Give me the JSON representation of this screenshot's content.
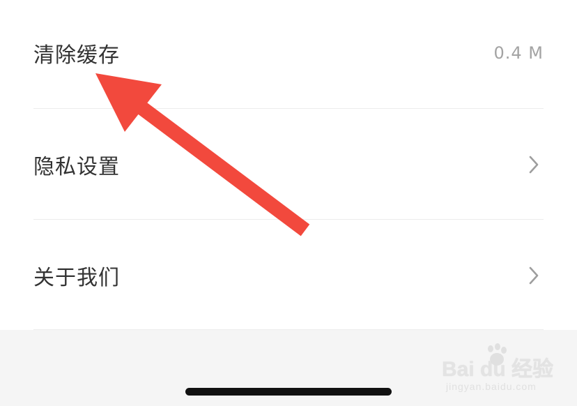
{
  "settings": {
    "items": [
      {
        "label": "清除缓存",
        "value": "0.4 M",
        "icon": "none"
      },
      {
        "label": "隐私设置",
        "value": "",
        "icon": "chevron-right-icon"
      },
      {
        "label": "关于我们",
        "value": "",
        "icon": "chevron-right-icon"
      }
    ]
  },
  "watermark": {
    "logo_text": "Bai du 经验",
    "url_text": "jingyan.baidu.com"
  },
  "colors": {
    "label": "#333333",
    "value": "#a3a3a3",
    "divider": "#ececec",
    "chevron": "#9e9e9e",
    "arrow": "#f2493d",
    "footer_bg": "#f5f5f5",
    "home_indicator": "#111111"
  }
}
